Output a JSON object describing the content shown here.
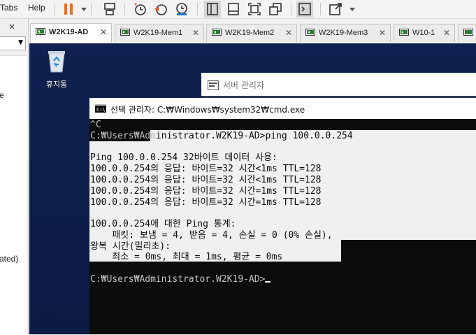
{
  "menubar": {
    "items": [
      "Tabs",
      "Help"
    ]
  },
  "toolbar": {
    "buttons": [
      "pause-icon",
      "dropdown-icon",
      "network-icon",
      "snapshot-icon",
      "revert-snapshot-icon",
      "snapshot-manager-icon",
      "library-view-icon",
      "console-view-icon",
      "fit-guest-icon",
      "unity-icon",
      "terminal-icon",
      "fullscreen-icon"
    ]
  },
  "left_panel": {
    "close_label": "×",
    "item_text": "e",
    "status_text": "ated)"
  },
  "tabs": [
    {
      "label": "W2K19-AD",
      "active": true
    },
    {
      "label": "W2K19-Mem1",
      "active": false
    },
    {
      "label": "W2K19-Mem2",
      "active": false
    },
    {
      "label": "W2K19-Mem3",
      "active": false
    },
    {
      "label": "W10-1",
      "active": false
    }
  ],
  "tab_close": "✕",
  "desktop": {
    "recycle_bin_label": "휴지통",
    "server_manager_title": "서버 관리자"
  },
  "cmd": {
    "title": "선택 관리자: C:₩Windows₩system32₩cmd.exe",
    "lines": [
      "^C",
      "C:₩Users₩Administrator.W2K19-AD>ping 100.0.0.254",
      "",
      "Ping 100.0.0.254 32바이트 데이터 사용:",
      "100.0.0.254의 응답: 바이트=32 시간<1ms TTL=128",
      "100.0.0.254의 응답: 바이트=32 시간<1ms TTL=128",
      "100.0.0.254의 응답: 바이트=32 시간=1ms TTL=128",
      "100.0.0.254의 응답: 바이트=32 시간=1ms TTL=128",
      "",
      "100.0.0.254에 대한 Ping 통계:",
      "    패킷: 보냄 = 4, 받음 = 4, 손실 = 0 (0% 손실),",
      "왕복 시간(밀리초):",
      "    최소 = 0ms, 최대 = 1ms, 평균 = 0ms",
      "",
      "C:₩Users₩Administrator.W2K19-AD>"
    ]
  },
  "colors": {
    "pause_orange": "#f26b1d",
    "desktop_blue": "#0f2150",
    "console_bg": "#0c0c0c",
    "selection_bg": "#f0f0f0"
  }
}
